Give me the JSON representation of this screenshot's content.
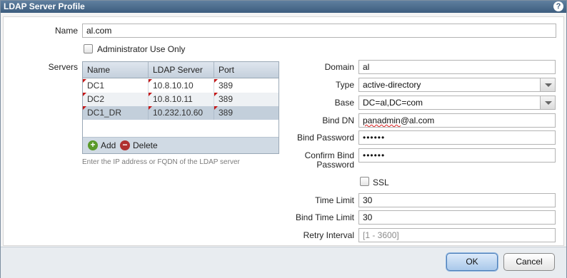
{
  "dialog": {
    "title": "LDAP Server Profile",
    "help_icon": "question-icon"
  },
  "name": {
    "label": "Name",
    "value": "al.com"
  },
  "admin_use_only": {
    "label": "Administrator Use Only",
    "checked": false
  },
  "servers": {
    "label": "Servers",
    "columns": [
      "Name",
      "LDAP Server",
      "Port"
    ],
    "rows": [
      {
        "name": "DC1",
        "server": "10.8.10.10",
        "port": "389",
        "selected": false
      },
      {
        "name": "DC2",
        "server": "10.8.10.11",
        "port": "389",
        "selected": false
      },
      {
        "name": "DC1_DR",
        "server": "10.232.10.60",
        "port": "389",
        "selected": true
      }
    ],
    "add_label": "Add",
    "delete_label": "Delete",
    "hint": "Enter the IP address or FQDN of the LDAP server"
  },
  "domain": {
    "label": "Domain",
    "value": "al"
  },
  "type": {
    "label": "Type",
    "value": "active-directory"
  },
  "base": {
    "label": "Base",
    "value": "DC=al,DC=com"
  },
  "bind_dn": {
    "label": "Bind DN",
    "value_underlined": "panadmin",
    "value_rest": "@al.com"
  },
  "bind_password": {
    "label": "Bind Password",
    "value": "••••••"
  },
  "confirm_password": {
    "label_line1": "Confirm Bind",
    "label_line2": "Password",
    "value": "••••••"
  },
  "ssl": {
    "label": "SSL",
    "checked": false
  },
  "time_limit": {
    "label": "Time Limit",
    "value": "30"
  },
  "bind_time_limit": {
    "label": "Bind Time Limit",
    "value": "30"
  },
  "retry_interval": {
    "label": "Retry Interval",
    "placeholder": "[1 - 3600]"
  },
  "footer": {
    "ok_label": "OK",
    "cancel_label": "Cancel"
  },
  "colors": {
    "titlebar": "#3d5d7e",
    "selected_row": "#c3cfdb",
    "dirty_flag": "#c41616",
    "add_icon": "#5a9a2a",
    "delete_icon": "#b03030"
  }
}
